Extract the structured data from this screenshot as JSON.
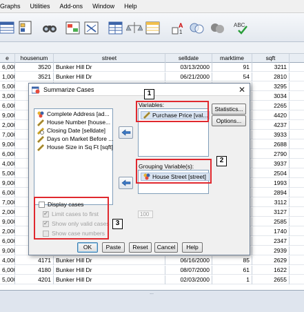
{
  "menu": [
    "Graphs",
    "Utilities",
    "Add-ons",
    "Window",
    "Help"
  ],
  "menu_partial_first": "",
  "grid": {
    "columns": [
      "e",
      "housenum",
      "street",
      "selldate",
      "marktime",
      "sqft"
    ],
    "rows": [
      [
        "6,000",
        "3520",
        "Bunker Hill Dr",
        "03/13/2000",
        "91",
        "3211"
      ],
      [
        "1,000",
        "3521",
        "Bunker Hill Dr",
        "06/21/2000",
        "54",
        "2810"
      ],
      [
        "5,000",
        "",
        "",
        "",
        "",
        "3295"
      ],
      [
        "3,000",
        "",
        "",
        "",
        "",
        "3034"
      ],
      [
        "6,000",
        "",
        "",
        "",
        "",
        "2265"
      ],
      [
        "9,000",
        "",
        "",
        "",
        "",
        "4420"
      ],
      [
        "2,000",
        "",
        "",
        "",
        "",
        "4237"
      ],
      [
        "7,000",
        "",
        "",
        "",
        "",
        "3933"
      ],
      [
        "9,000",
        "",
        "",
        "",
        "",
        "2688"
      ],
      [
        "6,000",
        "",
        "",
        "",
        "",
        "2790"
      ],
      [
        "4,000",
        "",
        "",
        "",
        "",
        "3937"
      ],
      [
        "5,000",
        "",
        "",
        "",
        "",
        "2504"
      ],
      [
        "9,000",
        "",
        "",
        "",
        "",
        "1993"
      ],
      [
        "6,000",
        "",
        "",
        "",
        "",
        "2894"
      ],
      [
        "7,000",
        "",
        "",
        "",
        "",
        "3112"
      ],
      [
        "2,000",
        "",
        "",
        "",
        "",
        "3127"
      ],
      [
        "9,000",
        "",
        "",
        "",
        "",
        "2585"
      ],
      [
        "2,000",
        "",
        "",
        "",
        "",
        "1740"
      ],
      [
        "6,000",
        "",
        "",
        "",
        "",
        "2347"
      ],
      [
        "9,000",
        "",
        "",
        "",
        "",
        "2939"
      ],
      [
        "4,000",
        "4171",
        "Bunker Hill Dr",
        "06/16/2000",
        "85",
        "2629"
      ],
      [
        "6,000",
        "4180",
        "Bunker Hill Dr",
        "08/07/2000",
        "61",
        "1622"
      ],
      [
        "5,000",
        "4201",
        "Bunker Hill Dr",
        "02/03/2000",
        "1",
        "2655"
      ]
    ]
  },
  "dialog": {
    "title": "Summarize Cases",
    "close": "✕",
    "source_items": [
      {
        "label": "Complete Address [ad...",
        "icon": "nominal-variable-icon"
      },
      {
        "label": "House Number [house...",
        "icon": "scale-variable-icon"
      },
      {
        "label": "Closing Date [selldate]",
        "icon": "date-variable-icon"
      },
      {
        "label": "Days on Market Before ...",
        "icon": "scale-variable-icon"
      },
      {
        "label": "House Size in Sq Ft [sqft]",
        "icon": "scale-variable-icon"
      }
    ],
    "variables_label": "Variables:",
    "variables_items": [
      "Purchase Price [val..."
    ],
    "grouping_label": "Grouping Variable(s):",
    "grouping_items": [
      "House Street [street]"
    ],
    "side_buttons": [
      "Statistics...",
      "Options..."
    ],
    "display_cases": "Display cases",
    "limit_cases": "Limit cases to first",
    "limit_value": "100",
    "show_valid": "Show only valid cases",
    "show_numbers": "Show case numbers",
    "buttons": [
      "OK",
      "Paste",
      "Reset",
      "Cancel",
      "Help"
    ]
  },
  "annotations": [
    "1",
    "2",
    "3"
  ],
  "colors": {
    "annotation_red": "#e0282e",
    "grid_header": "#e8edf3"
  },
  "bottom_grip": "..."
}
